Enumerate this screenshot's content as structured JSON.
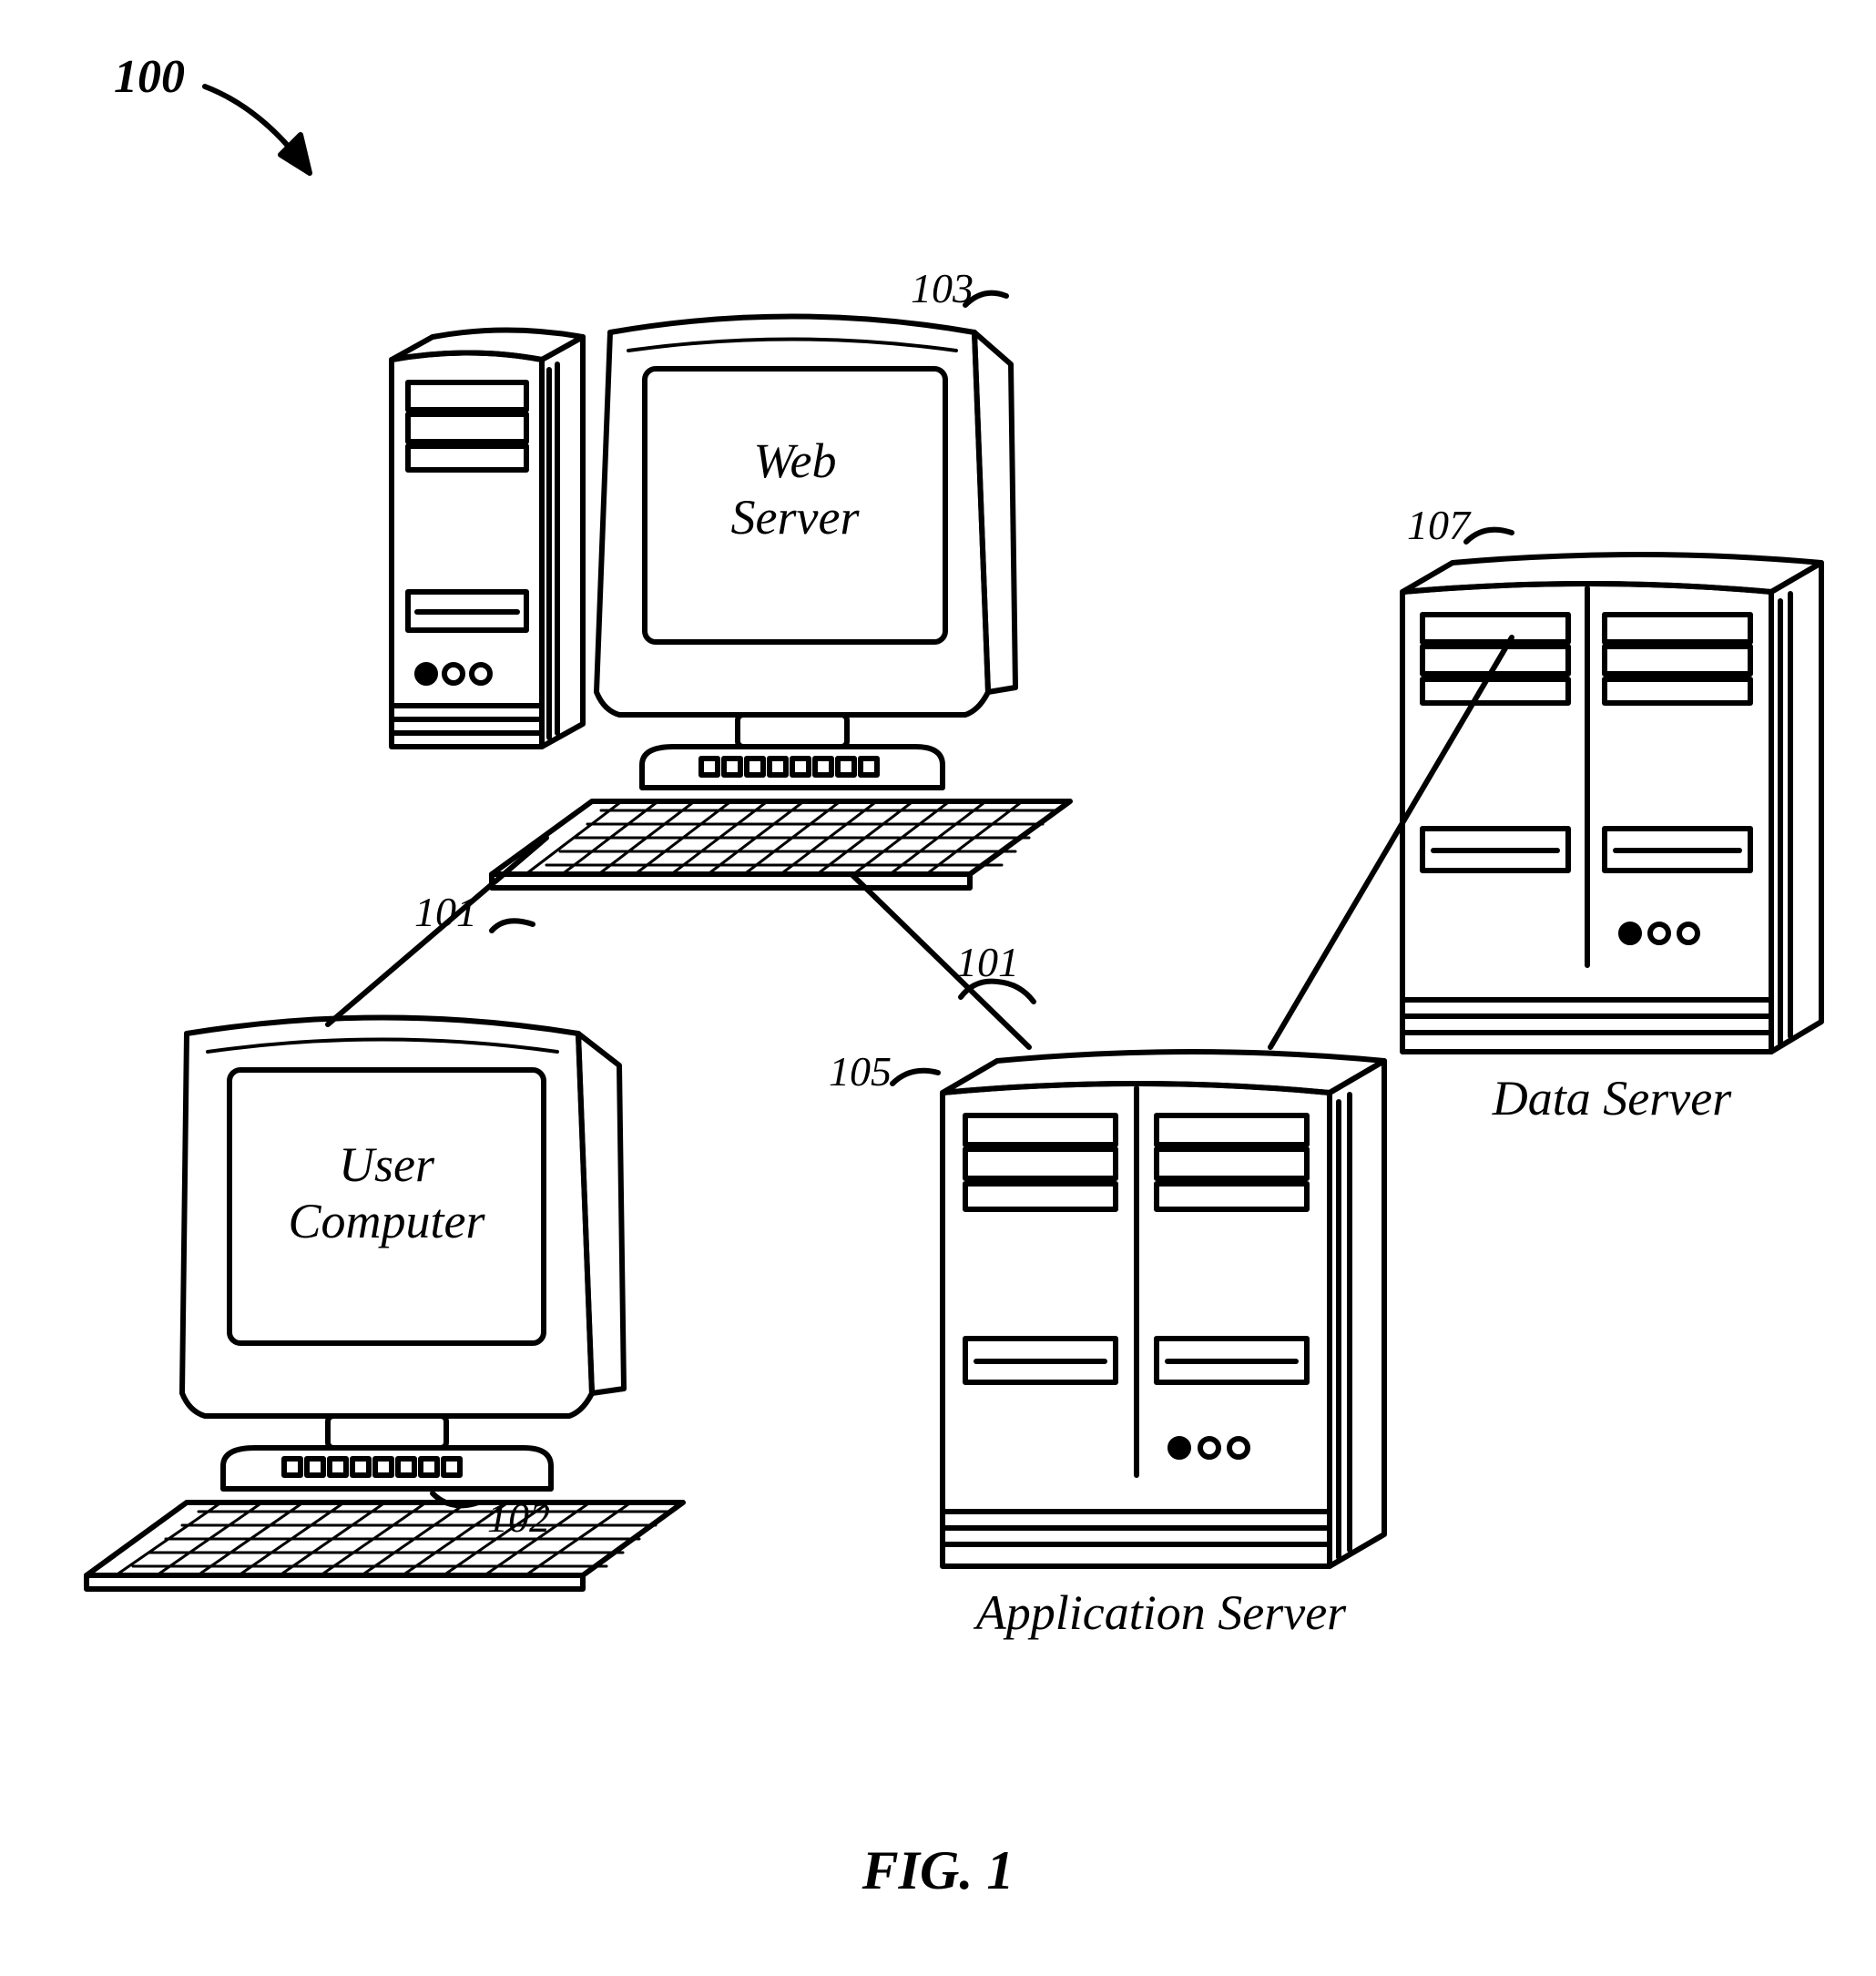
{
  "figure_ref": "100",
  "nodes": {
    "web_server": {
      "label": "Web\nServer",
      "ref": "103"
    },
    "user_computer": {
      "label": "User\nComputer",
      "ref": "102"
    },
    "application_server": {
      "label": "Application Server",
      "ref": "105"
    },
    "data_server": {
      "label": "Data Server",
      "ref": "107"
    }
  },
  "edges": {
    "link_user_web": {
      "ref": "101"
    },
    "link_web_app": {
      "ref": "101"
    }
  },
  "figure_title": "FIG. 1"
}
